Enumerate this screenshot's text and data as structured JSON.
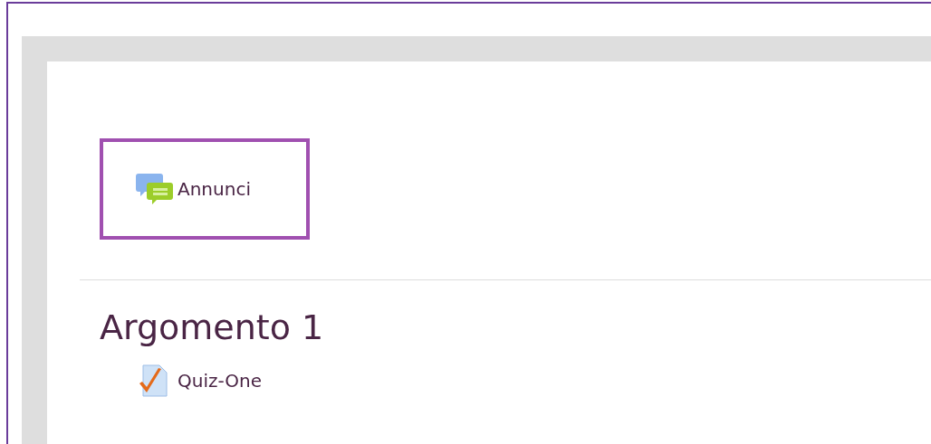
{
  "top_section": {
    "items": [
      {
        "label": "Annunci",
        "kind": "forum",
        "highlighted": true
      }
    ]
  },
  "sections": [
    {
      "title": "Argomento 1",
      "items": [
        {
          "label": "Quiz-One",
          "kind": "quiz",
          "highlighted": false
        }
      ]
    }
  ]
}
